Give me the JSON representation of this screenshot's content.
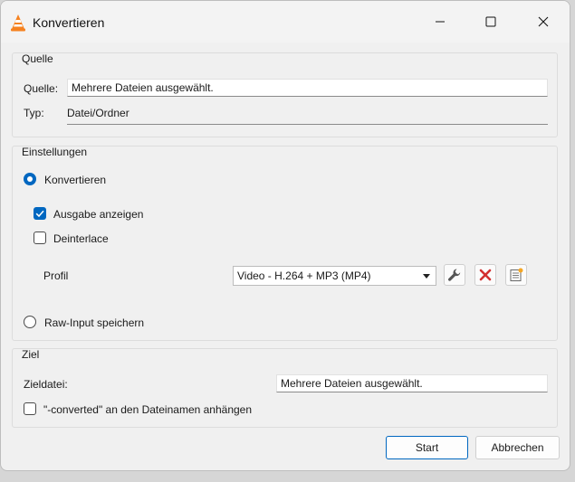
{
  "window": {
    "title": "Konvertieren"
  },
  "source": {
    "group_title": "Quelle",
    "source_label": "Quelle:",
    "source_value": "Mehrere Dateien ausgewählt.",
    "type_label": "Typ:",
    "type_value": "Datei/Ordner"
  },
  "settings": {
    "group_title": "Einstellungen",
    "convert_label": "Konvertieren",
    "convert_selected": true,
    "show_output_label": "Ausgabe anzeigen",
    "show_output_checked": true,
    "deinterlace_label": "Deinterlace",
    "deinterlace_checked": false,
    "profile_label": "Profil",
    "profile_value": "Video - H.264 + MP3 (MP4)",
    "raw_input_label": "Raw-Input speichern",
    "raw_input_selected": false
  },
  "target": {
    "group_title": "Ziel",
    "dest_label": "Zieldatei:",
    "dest_value": "Mehrere Dateien ausgewählt.",
    "append_label": "\"-converted\" an den Dateinamen anhängen",
    "append_checked": false
  },
  "buttons": {
    "start": "Start",
    "cancel": "Abbrechen"
  },
  "icons": {
    "app": "vlc-cone-icon",
    "edit_profile": "wrench-icon",
    "delete_profile": "red-x-icon",
    "new_profile": "new-list-icon"
  },
  "colors": {
    "accent": "#0067c0",
    "delete": "#d32f2f",
    "vlc_orange": "#f58220"
  }
}
